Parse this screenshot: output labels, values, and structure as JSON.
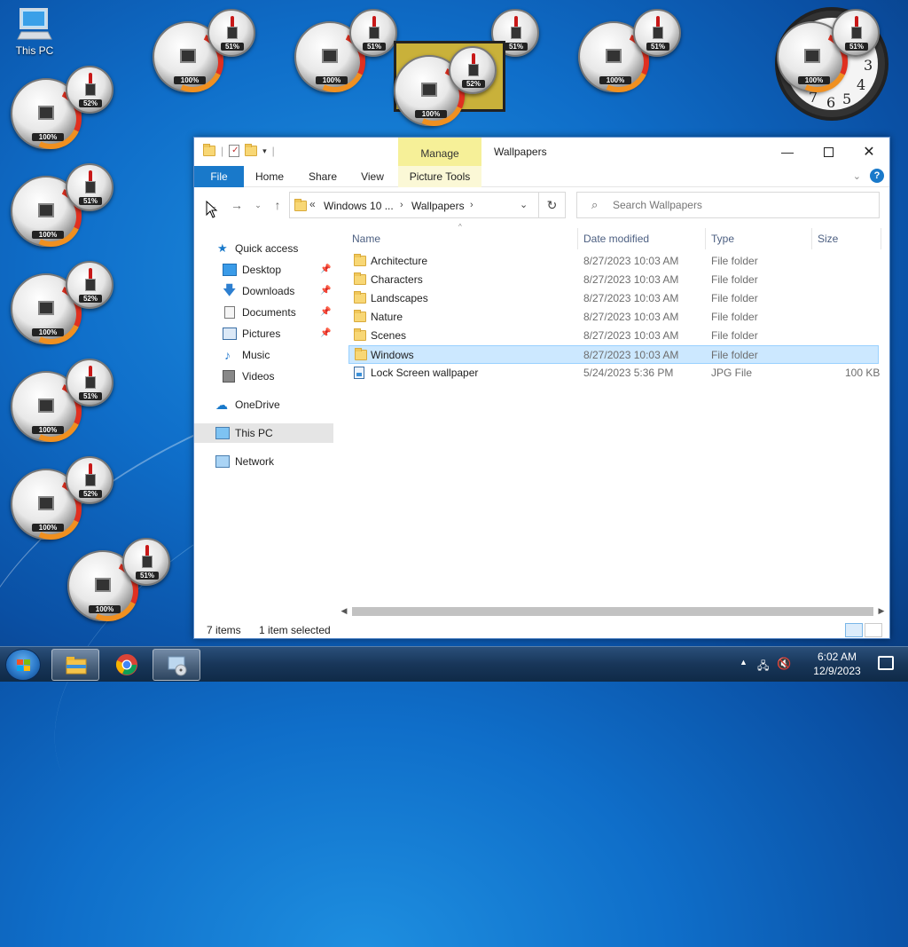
{
  "desktop": {
    "icons": [
      {
        "label": "This PC"
      }
    ],
    "gadgets": {
      "cpu_values": [
        "100%",
        "100%",
        "100%",
        "100%",
        "100%",
        "100%",
        "100%",
        "100%",
        "100%",
        "100%",
        "100%",
        "100%",
        "100%"
      ],
      "mem_values": [
        "51%",
        "51%",
        "51%",
        "51%",
        "51%",
        "52%",
        "51%",
        "52%",
        "51%",
        "52%",
        "51%",
        "52%",
        "51%"
      ]
    },
    "clock_numbers": [
      "3",
      "4",
      "5",
      "6",
      "7"
    ]
  },
  "window": {
    "title": "Wallpapers",
    "context_tab": "Manage",
    "ribbon": {
      "tabs": [
        "File",
        "Home",
        "Share",
        "View"
      ],
      "context_group": "Picture Tools"
    },
    "address": {
      "prefix": "«",
      "segment1": "Windows 10 ...",
      "segment2": "Wallpapers"
    },
    "search": {
      "placeholder": "Search Wallpapers"
    },
    "nav": {
      "quick_access": "Quick access",
      "items": [
        {
          "label": "Desktop",
          "pinned": true
        },
        {
          "label": "Downloads",
          "pinned": true
        },
        {
          "label": "Documents",
          "pinned": true
        },
        {
          "label": "Pictures",
          "pinned": true
        },
        {
          "label": "Music",
          "pinned": false
        },
        {
          "label": "Videos",
          "pinned": false
        }
      ],
      "onedrive": "OneDrive",
      "this_pc": "This PC",
      "network": "Network"
    },
    "columns": {
      "name": "Name",
      "date": "Date modified",
      "type": "Type",
      "size": "Size"
    },
    "files": [
      {
        "name": "Architecture",
        "date": "8/27/2023 10:03 AM",
        "type": "File folder",
        "size": ""
      },
      {
        "name": "Characters",
        "date": "8/27/2023 10:03 AM",
        "type": "File folder",
        "size": ""
      },
      {
        "name": "Landscapes",
        "date": "8/27/2023 10:03 AM",
        "type": "File folder",
        "size": ""
      },
      {
        "name": "Nature",
        "date": "8/27/2023 10:03 AM",
        "type": "File folder",
        "size": ""
      },
      {
        "name": "Scenes",
        "date": "8/27/2023 10:03 AM",
        "type": "File folder",
        "size": ""
      },
      {
        "name": "Windows",
        "date": "8/27/2023 10:03 AM",
        "type": "File folder",
        "size": ""
      },
      {
        "name": "Lock Screen wallpaper",
        "date": "5/24/2023 5:36 PM",
        "type": "JPG File",
        "size": "100 KB"
      }
    ],
    "status": {
      "count": "7 items",
      "selection": "1 item selected"
    }
  },
  "taskbar": {
    "time": "6:02 AM",
    "date": "12/9/2023"
  },
  "colors": {
    "accent": "#1979ca",
    "selection": "#cce8ff",
    "manage": "#f6f098"
  }
}
